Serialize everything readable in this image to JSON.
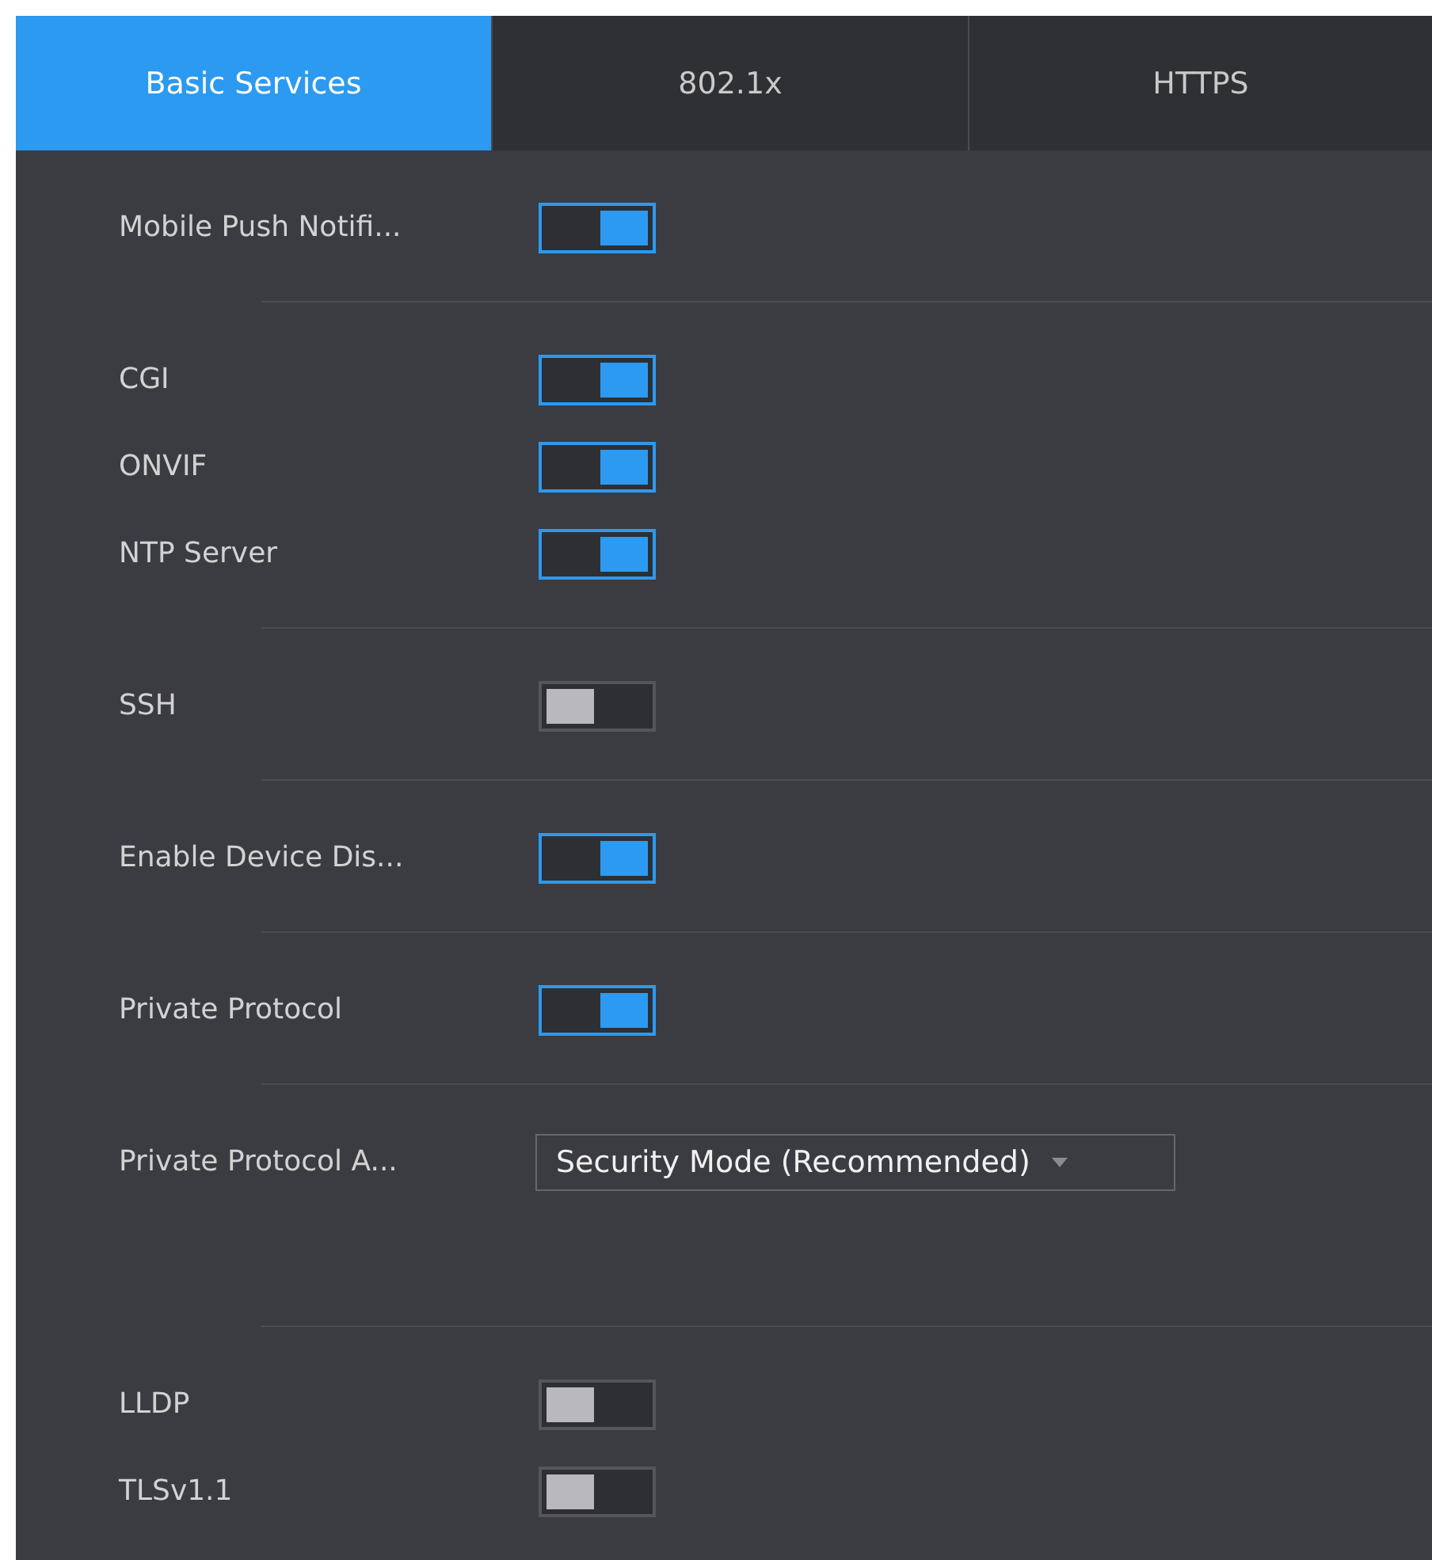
{
  "tabs": [
    {
      "label": "Basic Services",
      "selected": true
    },
    {
      "label": "802.1x",
      "selected": false
    },
    {
      "label": "HTTPS",
      "selected": false
    }
  ],
  "groups": [
    {
      "items": [
        {
          "kind": "toggle",
          "label": "Mobile Push Notifi...",
          "on": true
        }
      ]
    },
    {
      "items": [
        {
          "kind": "toggle",
          "label": "CGI",
          "on": true
        },
        {
          "kind": "toggle",
          "label": "ONVIF",
          "on": true
        },
        {
          "kind": "toggle",
          "label": "NTP Server",
          "on": true
        }
      ]
    },
    {
      "items": [
        {
          "kind": "toggle",
          "label": "SSH",
          "on": false
        }
      ]
    },
    {
      "items": [
        {
          "kind": "toggle",
          "label": "Enable Device Dis...",
          "on": true
        }
      ]
    },
    {
      "items": [
        {
          "kind": "toggle",
          "label": "Private Protocol",
          "on": true
        }
      ]
    },
    {
      "items": [
        {
          "kind": "select",
          "label": "Private Protocol A...",
          "value": "Security Mode (Recommended)"
        }
      ]
    },
    {
      "items": [
        {
          "kind": "toggle",
          "label": "LLDP",
          "on": false
        },
        {
          "kind": "toggle",
          "label": "TLSv1.1",
          "on": false
        }
      ]
    }
  ]
}
